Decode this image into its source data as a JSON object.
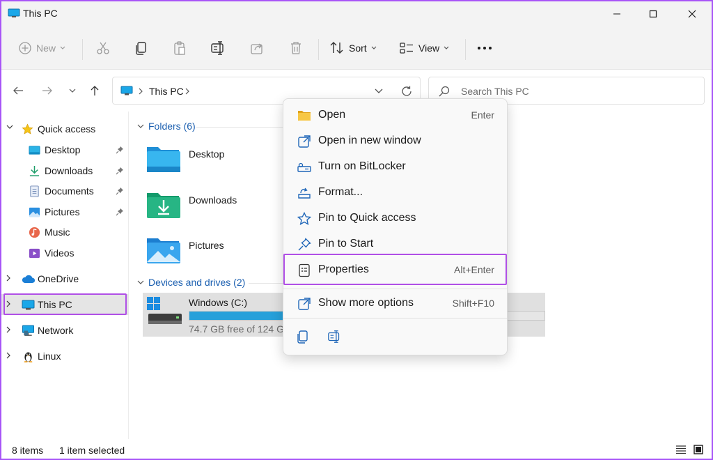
{
  "window": {
    "title": "This PC"
  },
  "toolbar": {
    "new_label": "New",
    "sort_label": "Sort",
    "view_label": "View"
  },
  "address": {
    "crumb": "This PC",
    "search_placeholder": "Search This PC"
  },
  "sidebar": {
    "quick_access": "Quick access",
    "items": [
      {
        "label": "Desktop",
        "icon": "desktop-icon",
        "pinned": true
      },
      {
        "label": "Downloads",
        "icon": "downloads-icon",
        "pinned": true
      },
      {
        "label": "Documents",
        "icon": "documents-icon",
        "pinned": true
      },
      {
        "label": "Pictures",
        "icon": "pictures-icon",
        "pinned": true
      },
      {
        "label": "Music",
        "icon": "music-icon",
        "pinned": false
      },
      {
        "label": "Videos",
        "icon": "videos-icon",
        "pinned": false
      }
    ],
    "onedrive": "OneDrive",
    "this_pc": "This PC",
    "network": "Network",
    "linux": "Linux"
  },
  "main": {
    "folders_header": "Folders (6)",
    "folders": [
      "Desktop",
      "Downloads",
      "Pictures"
    ],
    "drives_header": "Devices and drives (2)",
    "drive": {
      "name": "Windows (C:)",
      "free": "74.7 GB free of 124 GB",
      "used_fraction": 0.4
    }
  },
  "status": {
    "items": "8 items",
    "selected": "1 item selected"
  },
  "context_menu": {
    "items": [
      {
        "label": "Open",
        "shortcut": "Enter"
      },
      {
        "label": "Open in new window",
        "shortcut": ""
      },
      {
        "label": "Turn on BitLocker",
        "shortcut": ""
      },
      {
        "label": "Format...",
        "shortcut": ""
      },
      {
        "label": "Pin to Quick access",
        "shortcut": ""
      },
      {
        "label": "Pin to Start",
        "shortcut": ""
      },
      {
        "label": "Properties",
        "shortcut": "Alt+Enter"
      },
      {
        "label": "Show more options",
        "shortcut": "Shift+F10"
      }
    ]
  },
  "colors": {
    "accent": "#1b5fb0",
    "highlight": "#b04fe6",
    "drive_fill": "#26a0da"
  }
}
